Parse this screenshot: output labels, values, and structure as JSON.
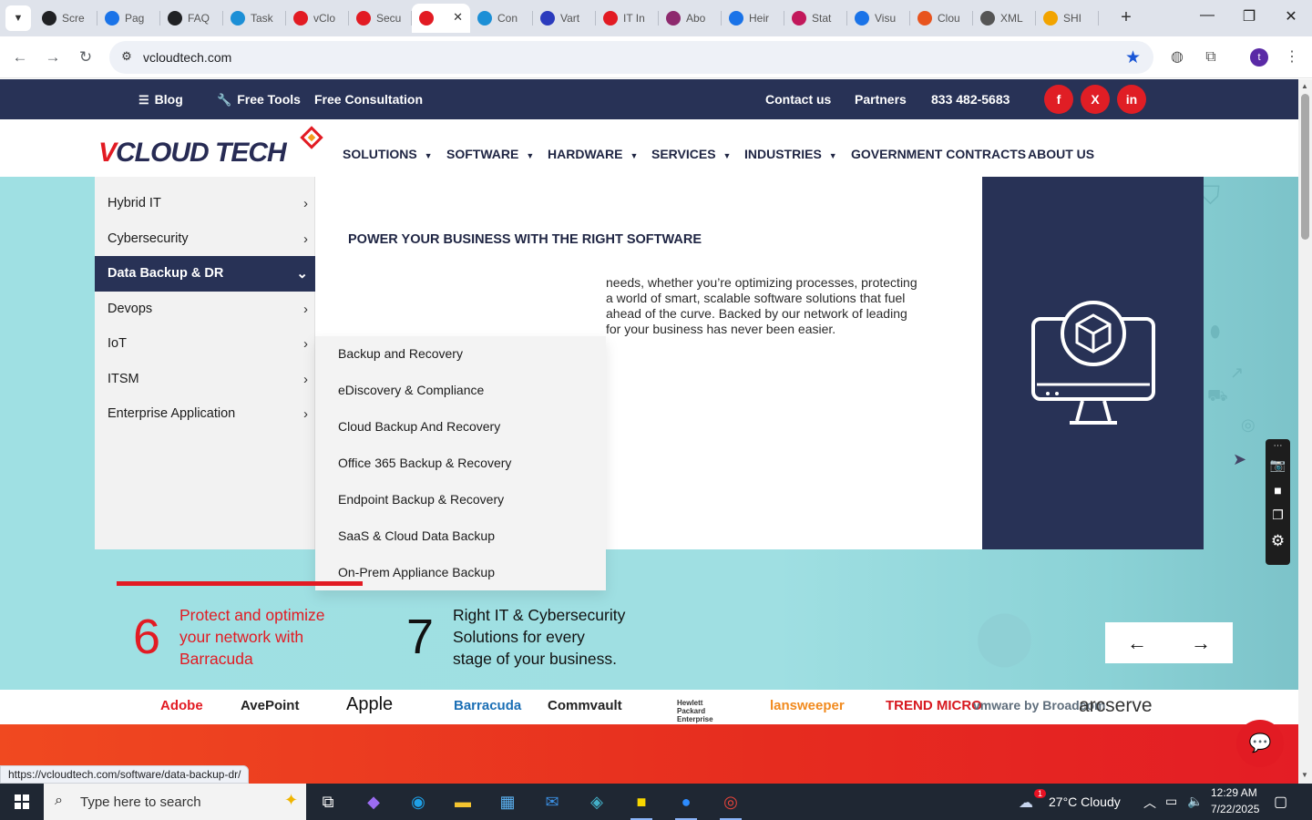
{
  "browser": {
    "tabs": [
      {
        "title": "Scre",
        "favicon_color": "#202124"
      },
      {
        "title": "Pag",
        "favicon_color": "#1a73e8"
      },
      {
        "title": "FAQ",
        "favicon_color": "#202124"
      },
      {
        "title": "Task",
        "favicon_color": "#1c8fd6"
      },
      {
        "title": "vClo",
        "favicon_color": "#e21b23"
      },
      {
        "title": "Secu",
        "favicon_color": "#e21b23"
      },
      {
        "title": "",
        "favicon_color": "#e21b23",
        "active": true
      },
      {
        "title": "Con",
        "favicon_color": "#1c8fd6"
      },
      {
        "title": "Vart",
        "favicon_color": "#2b3bbd"
      },
      {
        "title": "IT In",
        "favicon_color": "#e21b23"
      },
      {
        "title": "Abo",
        "favicon_color": "#8e2a6e"
      },
      {
        "title": "Heir",
        "favicon_color": "#1a73e8"
      },
      {
        "title": "Stat",
        "favicon_color": "#c2185b"
      },
      {
        "title": "Visu",
        "favicon_color": "#1a73e8"
      },
      {
        "title": "Clou",
        "favicon_color": "#e8541e"
      },
      {
        "title": "XML",
        "favicon_color": "#555555"
      },
      {
        "title": "SHI",
        "favicon_color": "#f2a400"
      }
    ],
    "url": "vcloudtech.com",
    "profile_initial": "t",
    "status_url": "https://vcloudtech.com/software/data-backup-dr/"
  },
  "topbar": {
    "blog": "Blog",
    "free_tools": "Free Tools",
    "free_consultation": "Free Consultation",
    "contact": "Contact us",
    "partners": "Partners",
    "phone": "833 482-5683",
    "social": [
      "f",
      "X",
      "in"
    ]
  },
  "logo": {
    "v": "V",
    "rest": "CLOUD TECH"
  },
  "nav": [
    {
      "label": "SOLUTIONS",
      "dropdown": true
    },
    {
      "label": "SOFTWARE",
      "dropdown": true
    },
    {
      "label": "HARDWARE",
      "dropdown": true
    },
    {
      "label": "SERVICES",
      "dropdown": true
    },
    {
      "label": "INDUSTRIES",
      "dropdown": true
    },
    {
      "label": "GOVERNMENT CONTRACTS",
      "dropdown": false
    },
    {
      "label": "ABOUT US",
      "dropdown": false
    }
  ],
  "mega": {
    "categories": [
      {
        "label": "Hybrid IT",
        "active": false
      },
      {
        "label": "Cybersecurity",
        "active": false
      },
      {
        "label": "Data Backup & DR",
        "active": true
      },
      {
        "label": "Devops",
        "active": false
      },
      {
        "label": "IoT",
        "active": false
      },
      {
        "label": "ITSM",
        "active": false
      },
      {
        "label": "Enterprise Application",
        "active": false
      }
    ],
    "heading": "POWER YOUR BUSINESS WITH THE RIGHT SOFTWARE",
    "text_lines": [
      "needs, whether you’re optimizing processes, protecting",
      "a world of smart, scalable software solutions that fuel",
      "ahead of the curve. Backed by our network of leading",
      "for your business has never been easier."
    ],
    "submenu": [
      "Backup and Recovery",
      "eDiscovery & Compliance",
      "Cloud Backup And Recovery",
      "Office 365 Backup & Recovery",
      "Endpoint Backup & Recovery",
      "SaaS & Cloud Data Backup",
      "On-Prem Appliance Backup"
    ]
  },
  "stats": [
    {
      "number": "6",
      "text": [
        "Protect and optimize",
        "your network with",
        "Barracuda"
      ],
      "color": "#e21b23"
    },
    {
      "number": "7",
      "text": [
        "Right IT & Cybersecurity",
        "Solutions for every",
        "stage of your business."
      ],
      "color": "#111111"
    }
  ],
  "carousel": {
    "prev": "←",
    "next": "→"
  },
  "partners": [
    {
      "name": "Adobe",
      "color": "#e21b23"
    },
    {
      "name": "AvePoint",
      "color": "#222222"
    },
    {
      "name": "Apple",
      "color": "#111111"
    },
    {
      "name": "Barracuda",
      "color": "#1b6fb5"
    },
    {
      "name": "Commvault",
      "color": "#222222"
    },
    {
      "name": "Hewlett Packard Enterprise",
      "color": "#333333"
    },
    {
      "name": "lansweeper",
      "color": "#f18a1e"
    },
    {
      "name": "TREND MICRO",
      "color": "#d71920"
    },
    {
      "name": "vmware by Broadcom",
      "color": "#5f6e7c"
    },
    {
      "name": "arcserve",
      "color": "#333333"
    }
  ],
  "taskbar": {
    "search_placeholder": "Type here to search",
    "weather": "27°C  Cloudy",
    "time": "12:29 AM",
    "date": "7/22/2025",
    "notification_count": "1"
  }
}
